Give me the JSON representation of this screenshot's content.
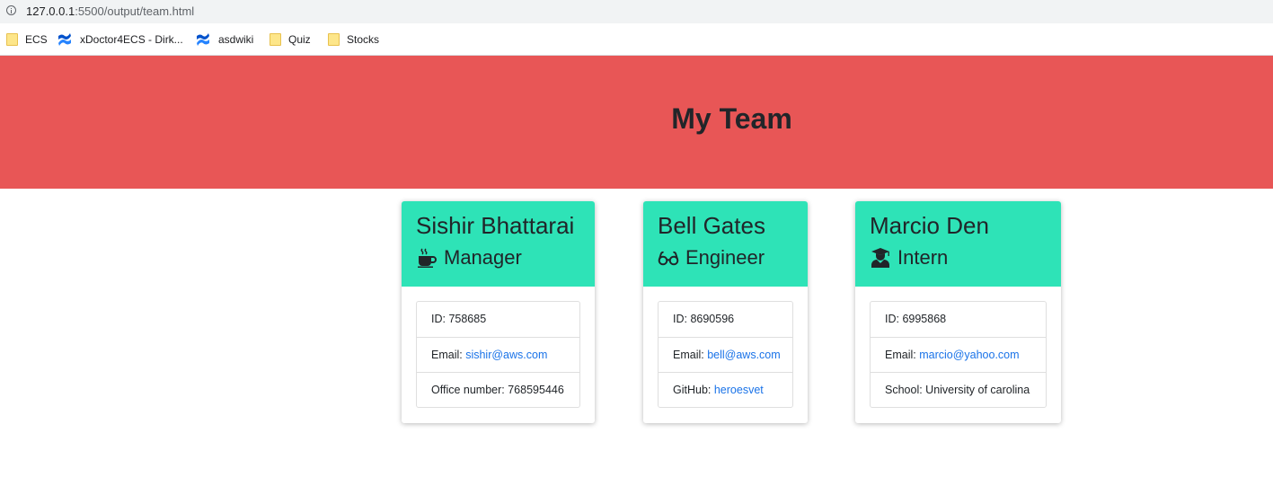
{
  "browser": {
    "url_host": "127.0.0.1",
    "url_rest": ":5500/output/team.html",
    "bookmarks": [
      {
        "label": "ECS",
        "icon": "folder-icon"
      },
      {
        "label": "xDoctor4ECS - Dirk...",
        "icon": "confluence-icon"
      },
      {
        "label": "asdwiki",
        "icon": "confluence-icon"
      },
      {
        "label": "Quiz",
        "icon": "folder-icon"
      },
      {
        "label": "Stocks",
        "icon": "folder-icon"
      }
    ]
  },
  "header": {
    "title": "My Team",
    "background_color": "#e85656"
  },
  "colors": {
    "card_header": "#2ee3b7",
    "link": "#1a73e8"
  },
  "team": [
    {
      "name": "Sishir Bhattarai",
      "role": "Manager",
      "role_icon": "mug-icon",
      "id_label": "ID: ",
      "id": "758685",
      "email_label": "Email: ",
      "email": "sishir@aws.com",
      "extra_label": "Office number: ",
      "extra_value": "768595446"
    },
    {
      "name": "Bell Gates",
      "role": "Engineer",
      "role_icon": "glasses-icon",
      "id_label": "ID: ",
      "id": "8690596",
      "email_label": "Email: ",
      "email": "bell@aws.com",
      "extra_label": "GitHub: ",
      "extra_value": "heroesvet"
    },
    {
      "name": "Marcio Den",
      "role": "Intern",
      "role_icon": "graduate-icon",
      "id_label": "ID: ",
      "id": "6995868",
      "email_label": "Email: ",
      "email": "marcio@yahoo.com",
      "extra_label": "School: ",
      "extra_value": "University of carolina"
    }
  ]
}
